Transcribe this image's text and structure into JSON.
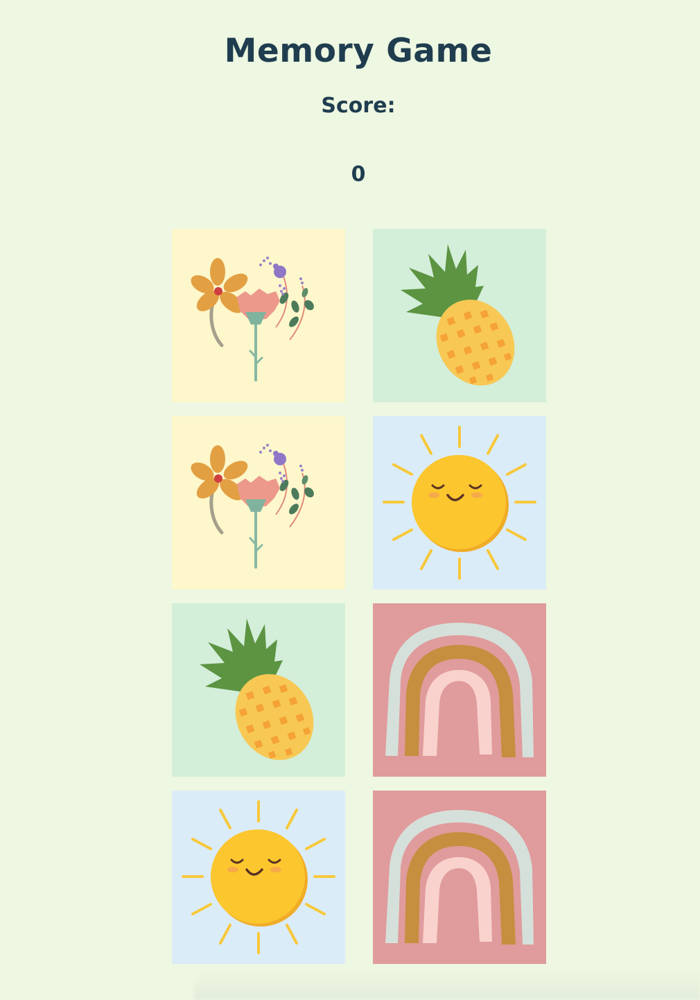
{
  "header": {
    "title": "Memory Game",
    "score_label": "Score:",
    "score_value": "0"
  },
  "colors": {
    "background": "#edf7e1",
    "text": "#1f3d4f",
    "flower_bg": "#fdf7cb",
    "pineapple_bg": "#d3eed9",
    "sun_bg": "#dbecf9",
    "rainbow_bg": "#e09b9c"
  },
  "cards": [
    {
      "icon": "flower-icon",
      "face": "up"
    },
    {
      "icon": "pineapple-icon",
      "face": "up"
    },
    {
      "icon": "flower-icon",
      "face": "up"
    },
    {
      "icon": "sun-icon",
      "face": "up"
    },
    {
      "icon": "pineapple-icon",
      "face": "up"
    },
    {
      "icon": "rainbow-icon",
      "face": "up"
    },
    {
      "icon": "sun-icon",
      "face": "up"
    },
    {
      "icon": "rainbow-icon",
      "face": "up"
    }
  ]
}
